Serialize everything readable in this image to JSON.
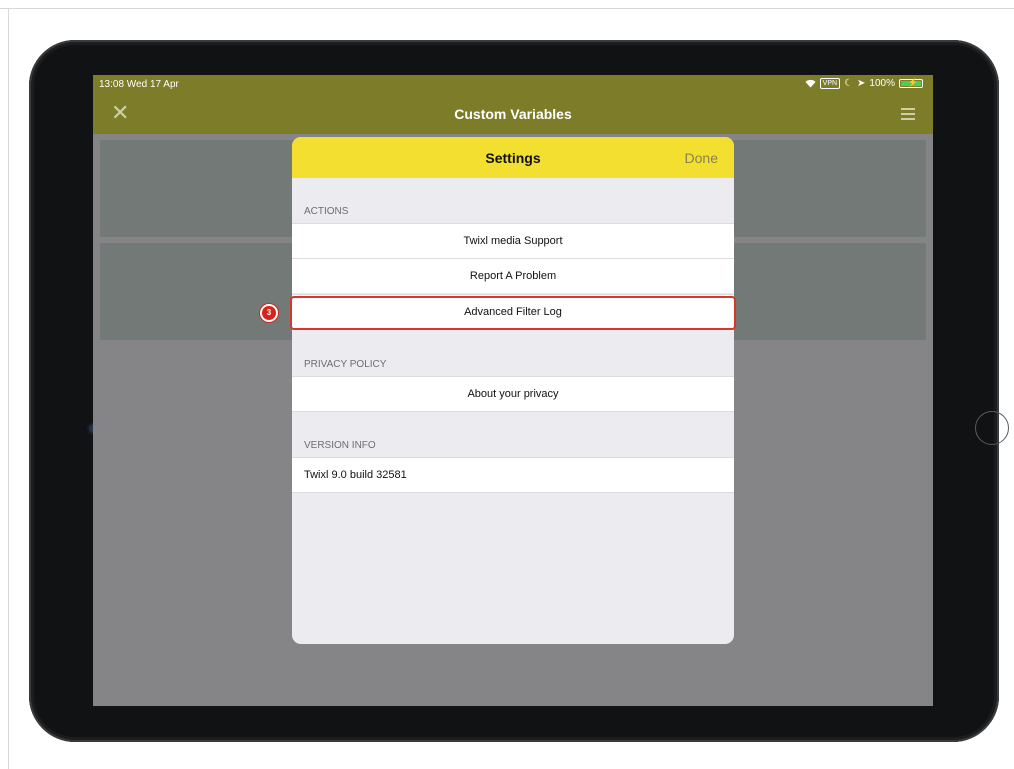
{
  "status_bar": {
    "time": "13:08  Wed 17 Apr",
    "vpn": "VPN",
    "battery": "100%",
    "icons": [
      "wifi-icon",
      "vpn-icon",
      "moon-icon",
      "location-icon",
      "battery-icon"
    ]
  },
  "nav": {
    "title": "Custom Variables",
    "close_icon": "✕",
    "menu_icon": "hamburger-menu-icon"
  },
  "settings": {
    "title": "Settings",
    "done_label": "Done",
    "sections": {
      "actions": {
        "label": "ACTIONS",
        "items": [
          "Twixl media Support",
          "Report A Problem",
          "Advanced Filter Log"
        ]
      },
      "privacy": {
        "label": "PRIVACY POLICY",
        "items": [
          "About your privacy"
        ]
      },
      "version": {
        "label": "VERSION INFO",
        "value": "Twixl 9.0 build 32581"
      }
    }
  },
  "annotation": {
    "step_number": "3",
    "color": "#d5382a"
  },
  "colors": {
    "nav_bar": "#7d7c28",
    "modal_header": "#f2df30",
    "done_text": "#8a8150"
  }
}
